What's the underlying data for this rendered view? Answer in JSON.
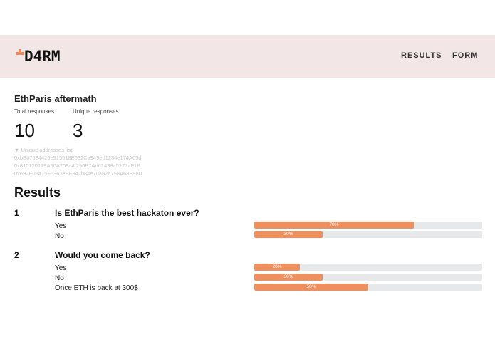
{
  "brand": {
    "logo_text": "D4RM",
    "accent_color": "#f08a5d"
  },
  "nav": {
    "results": "RESULTS",
    "form": "FORM"
  },
  "form": {
    "title": "EthParis aftermath",
    "total_label": "Total responses",
    "total_value": "10",
    "unique_label": "Unique responses",
    "unique_value": "3",
    "addresses_toggle": "▼ Unique addresses list",
    "addresses": [
      "0xbB67584425e915518E632Ca949ed1234e174A63d",
      "0x810120179A50A708a4f296B7Ad61438a5227aE18",
      "0x692E08475F5363eBF842b84e70a82a758A68E980"
    ]
  },
  "results": {
    "heading": "Results",
    "questions": [
      {
        "number": "1",
        "text": "Is EthParis the best hackaton ever?",
        "options": [
          {
            "label": "Yes",
            "percent": 70,
            "percent_label": "70%"
          },
          {
            "label": "No",
            "percent": 30,
            "percent_label": "30%"
          }
        ]
      },
      {
        "number": "2",
        "text": "Would you come back?",
        "options": [
          {
            "label": "Yes",
            "percent": 20,
            "percent_label": "20%"
          },
          {
            "label": "No",
            "percent": 30,
            "percent_label": "30%"
          },
          {
            "label": "Once ETH is back at 300$",
            "percent": 50,
            "percent_label": "50%"
          }
        ]
      }
    ]
  },
  "colors": {
    "header_bg": "#f3e6e6",
    "bar_fill": "#ef8f5e",
    "bar_track": "#e7e8ea"
  }
}
